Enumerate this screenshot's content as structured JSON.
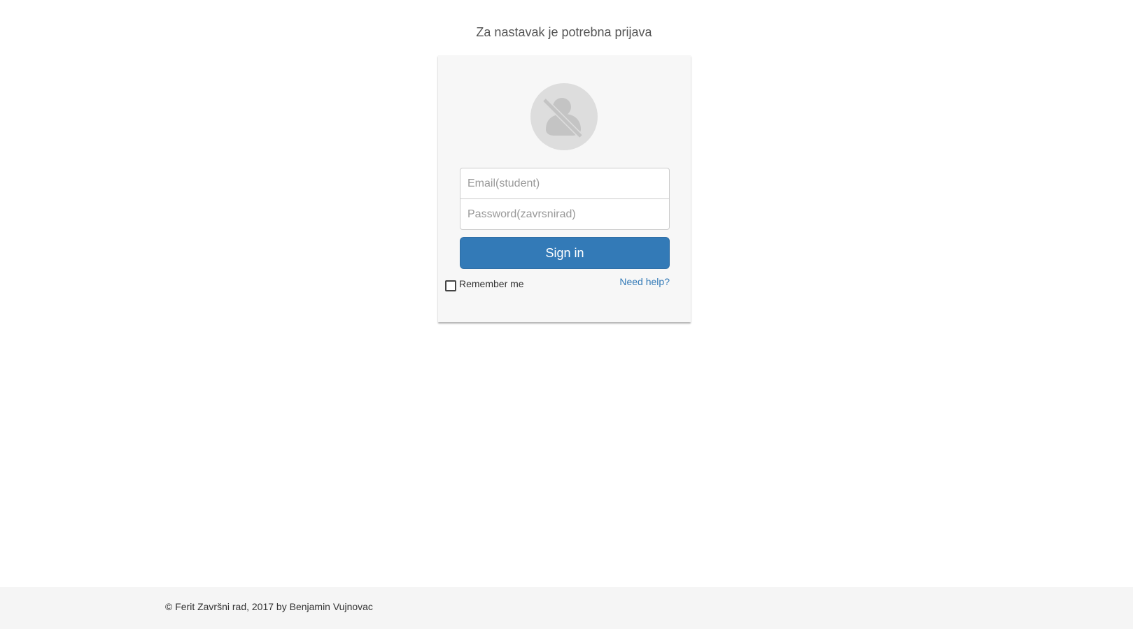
{
  "header": {
    "title": "Za nastavak je potrebna prijava"
  },
  "login": {
    "avatar_icon": "user-disabled-icon",
    "email_placeholder": "Email(student)",
    "email_value": "",
    "password_placeholder": "Password(zavrsnirad)",
    "password_value": "",
    "signin_label": "Sign in",
    "remember_label": "Remember me",
    "remember_checked": false,
    "help_label": "Need help?"
  },
  "footer": {
    "text": "© Ferit Završni rad, 2017 by Benjamin Vujnovac"
  },
  "colors": {
    "primary": "#337ab7",
    "card_bg": "#f7f7f7",
    "footer_bg": "#f5f5f5"
  }
}
